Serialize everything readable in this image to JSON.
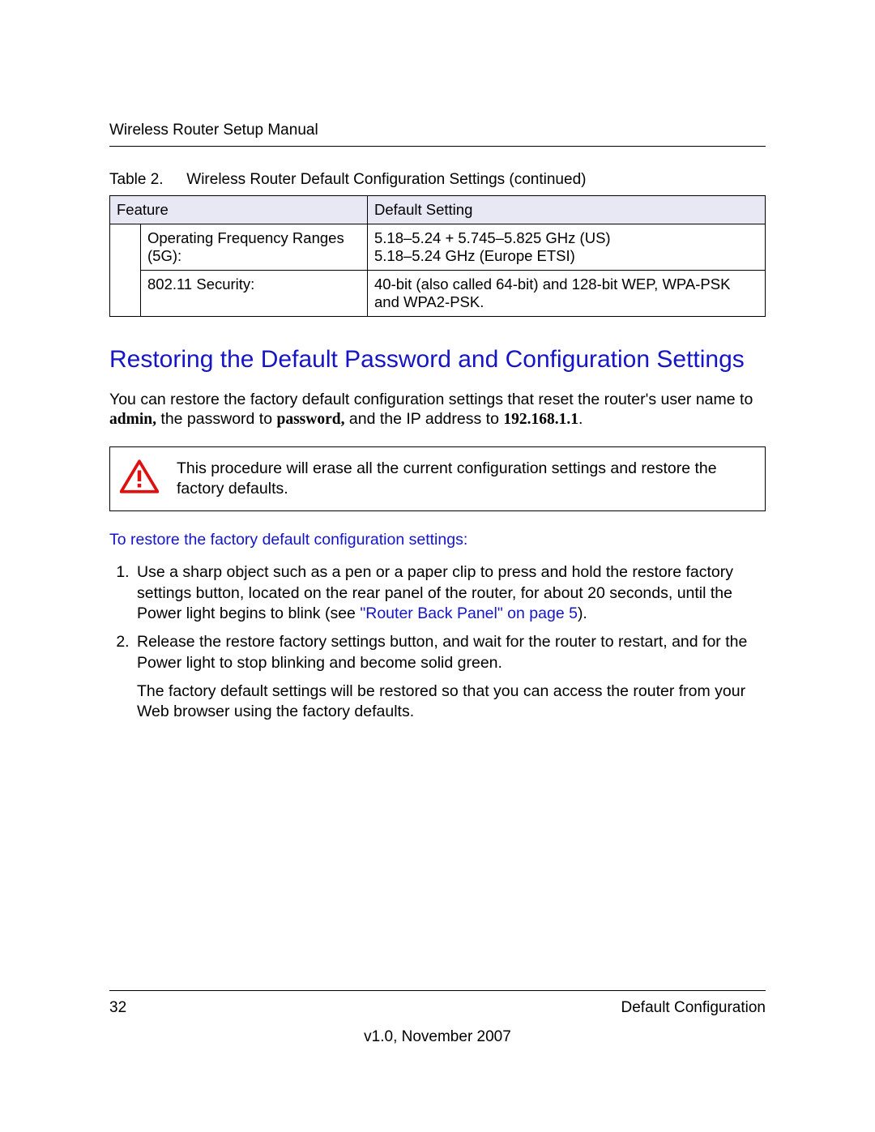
{
  "header": {
    "title": "Wireless Router Setup Manual"
  },
  "table": {
    "caption_label": "Table 2.",
    "caption_text": "Wireless Router Default Configuration Settings (continued)",
    "head_feature": "Feature",
    "head_default": "Default Setting",
    "rows": [
      {
        "feature": "Operating Frequency Ranges (5G):",
        "value_line1": "5.18–5.24 + 5.745–5.825 GHz (US)",
        "value_line2": "5.18–5.24 GHz (Europe ETSI)"
      },
      {
        "feature": "802.11 Security:",
        "value": "40-bit (also called 64-bit) and 128-bit WEP, WPA-PSK and WPA2-PSK."
      }
    ]
  },
  "section_heading": "Restoring the Default Password and Configuration Settings",
  "intro": {
    "pre": "You can restore the factory default configuration settings that reset the router's user name to ",
    "admin": "admin,",
    "mid1": " the password to ",
    "password": "password,",
    "mid2": " and the IP address to ",
    "ip": "192.168.1.1",
    "end": "."
  },
  "warning": {
    "text": "This procedure will erase all the current configuration settings and restore the factory defaults."
  },
  "subhead": "To restore the factory default configuration settings:",
  "steps": {
    "s1_pre": "Use a sharp object such as a pen or a paper clip to press and hold the restore factory settings button, located on the rear panel of the router, for about 20 seconds, until the Power light begins to blink (see ",
    "s1_link": "\"Router Back Panel\" on page 5",
    "s1_post": ").",
    "s2_main": "Release the restore factory settings button, and wait for the router to restart, and for the Power light to stop blinking and become solid green.",
    "s2_after": "The factory default settings will be restored so that you can access the router from your Web browser using the factory defaults."
  },
  "footer": {
    "page": "32",
    "section": "Default Configuration",
    "version": "v1.0, November 2007"
  }
}
